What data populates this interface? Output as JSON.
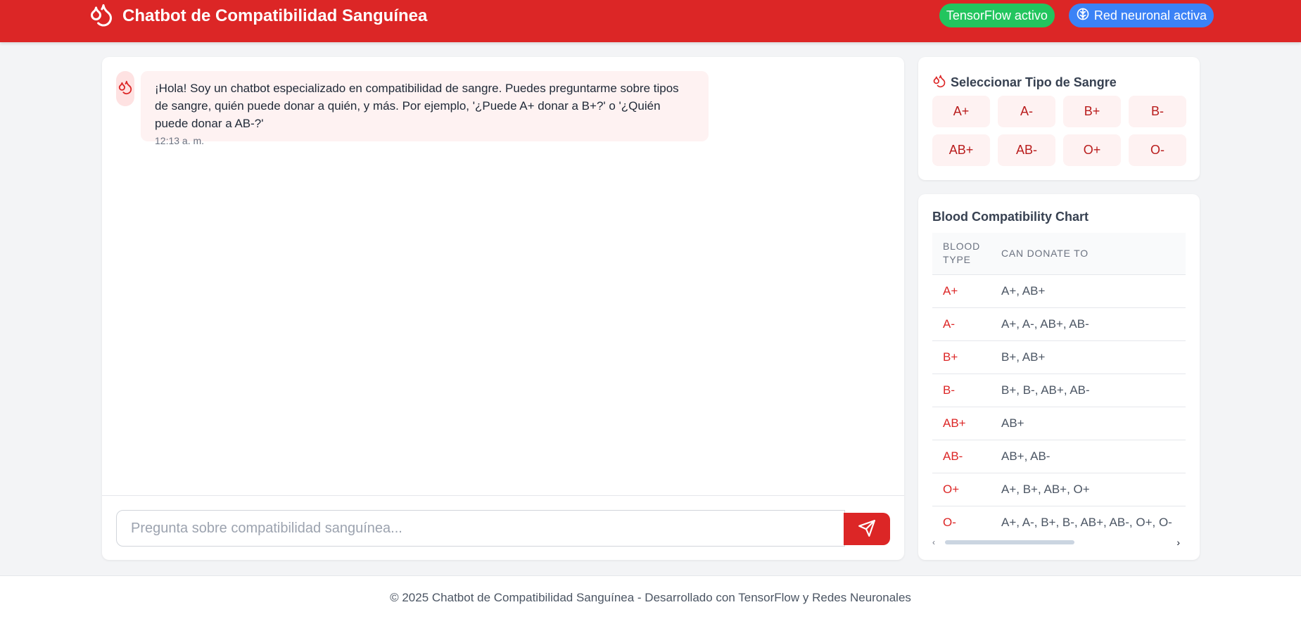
{
  "header": {
    "title": "Chatbot de Compatibilidad Sanguínea",
    "badges": [
      {
        "label": "TensorFlow activo",
        "color": "#22c55e"
      },
      {
        "label": "Red neuronal activa",
        "color": "#3b82f6",
        "icon": "brain-icon"
      }
    ],
    "brand_color": "#dc2626"
  },
  "chat": {
    "messages": [
      {
        "sender": "bot",
        "text": "¡Hola! Soy un chatbot especializado en compatibilidad de sangre. Puedes preguntarme sobre tipos de sangre, quién puede donar a quién, y más. Por ejemplo, '¿Puede A+ donar a B+?' o '¿Quién puede donar a AB-?'",
        "time": "12:13 a. m."
      }
    ],
    "input_placeholder": "Pregunta sobre compatibilidad sanguínea...",
    "input_value": ""
  },
  "selector": {
    "title": "Seleccionar Tipo de Sangre",
    "types": [
      "A+",
      "A-",
      "B+",
      "B-",
      "AB+",
      "AB-",
      "O+",
      "O-"
    ]
  },
  "chart": {
    "title": "Blood Compatibility Chart",
    "headers": [
      "BLOOD TYPE",
      "CAN DONATE TO"
    ],
    "rows": [
      {
        "type": "A+",
        "donate": "A+, AB+"
      },
      {
        "type": "A-",
        "donate": "A+, A-, AB+, AB-"
      },
      {
        "type": "B+",
        "donate": "B+, AB+"
      },
      {
        "type": "B-",
        "donate": "B+, B-, AB+, AB-"
      },
      {
        "type": "AB+",
        "donate": "AB+"
      },
      {
        "type": "AB-",
        "donate": "AB+, AB-"
      },
      {
        "type": "O+",
        "donate": "A+, B+, AB+, O+"
      },
      {
        "type": "O-",
        "donate": "A+, A-, B+, B-, AB+, AB-, O+, O-"
      }
    ]
  },
  "footer": {
    "text": "© 2025 Chatbot de Compatibilidad Sanguínea - Desarrollado con TensorFlow y Redes Neuronales"
  }
}
